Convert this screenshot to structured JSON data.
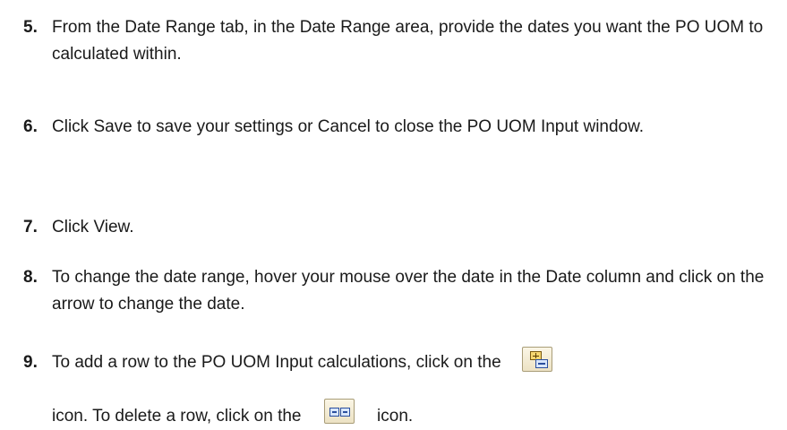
{
  "steps": [
    {
      "num": "5.",
      "text": "From the Date Range tab, in the Date Range area, provide the dates you want the PO UOM to calculated within."
    },
    {
      "num": "6.",
      "text": "Click Save to save your settings or Cancel to close the PO UOM Input window."
    },
    {
      "num": "7.",
      "text": "Click View."
    },
    {
      "num": "8.",
      "text": "To change the date range, hover your mouse over the date in the Date column and click on the arrow to change the date."
    },
    {
      "num": "9.",
      "line1": "To add a row to the PO UOM Input calculations, click on the",
      "line2a": "icon. To delete a row, click on the",
      "line2b": "icon."
    }
  ],
  "icons": {
    "add": "add-row-icon",
    "delete": "delete-row-icon"
  }
}
